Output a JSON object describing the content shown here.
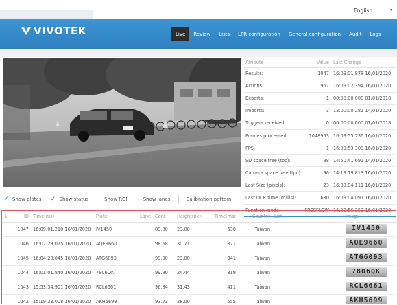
{
  "language": {
    "selected": "English"
  },
  "brand": {
    "name": "VIVOTEK"
  },
  "nav": {
    "items": [
      {
        "label": "Live",
        "active": true
      },
      {
        "label": "Review",
        "active": false
      },
      {
        "label": "Lists",
        "active": false
      },
      {
        "label": "LPR configuration",
        "active": false
      },
      {
        "label": "General configuration",
        "active": false
      },
      {
        "label": "Audit",
        "active": false
      },
      {
        "label": "Logs",
        "active": false
      }
    ]
  },
  "checkboxes": [
    {
      "label": "Show plates",
      "checked": true
    },
    {
      "label": "Show status",
      "checked": true
    },
    {
      "label": "Show ROI",
      "checked": false
    },
    {
      "label": "Show lanes",
      "checked": false
    },
    {
      "label": "Calibration pattern",
      "checked": false
    }
  ],
  "stats": {
    "headers": {
      "attribute": "Atribute",
      "value": "Value",
      "last_change": "Last Change"
    },
    "rows": [
      {
        "attribute": "Results:",
        "value": "1047",
        "last_change": "16:09:01.878 16/01/2020"
      },
      {
        "attribute": "Actions:",
        "value": "967",
        "last_change": "16:09:02.394 16/01/2020"
      },
      {
        "attribute": "Exports:",
        "value": "1",
        "last_change": "00:00:00.000 01/01/2018"
      },
      {
        "attribute": "Imports:",
        "value": "3",
        "last_change": "13:00:00.281 14/01/2020"
      },
      {
        "attribute": "Triggers received:",
        "value": "0",
        "last_change": "00:00:00.000 01/01/2018"
      },
      {
        "attribute": "Frames processed:",
        "value": "1048953",
        "last_change": "16:09:55.736 16/01/2020"
      },
      {
        "attribute": "FPS:",
        "value": "1",
        "last_change": "16:09:53.309 16/01/2020"
      },
      {
        "attribute": "SD space free (tpc):",
        "value": "98",
        "last_change": "14:50:41.692 14/01/2020"
      },
      {
        "attribute": "Camera space free (tpc):",
        "value": "96",
        "last_change": "14:13:19.813 16/01/2020"
      },
      {
        "attribute": "Last Size (pixels):",
        "value": "23",
        "last_change": "16:09:04.111 16/01/2020"
      },
      {
        "attribute": "Last OCR time (millis):",
        "value": "630",
        "last_change": "16:09:04.097 16/01/2020"
      },
      {
        "attribute": "Function mode:",
        "value": "FREEFLOW",
        "last_change": "16:09:56.352 16/01/2020"
      }
    ]
  },
  "results": {
    "headers": {
      "sort": "↓",
      "id": "ID",
      "time": "Time(ms)",
      "plate": "Plate",
      "lane": "Lane",
      "conf": "Conf.",
      "height": "Height(px)",
      "timems": "Time(ms)",
      "country": "Country",
      "list": "List",
      "image": "Image"
    },
    "rows": [
      {
        "id": "1047",
        "time": "16:09:01.210 16/01/2020",
        "plate": "IV1450",
        "conf": "89.80",
        "height": "23.00",
        "timems": "630",
        "country": "Taiwan",
        "image_text": "IV1450"
      },
      {
        "id": "1046",
        "time": "16:07:29.075 16/01/2020",
        "plate": "AQE9660",
        "conf": "98.68",
        "height": "30.71",
        "timems": "371",
        "country": "Taiwan",
        "image_text": "AQE9660"
      },
      {
        "id": "1045",
        "time": "16:04:20.045 16/01/2020",
        "plate": "ATG6093",
        "conf": "99.90",
        "height": "23.00",
        "timems": "341",
        "country": "Taiwan",
        "image_text": "ATG6093"
      },
      {
        "id": "1044",
        "time": "16:01:01.840 16/01/2020",
        "plate": "7806QK",
        "conf": "99.90",
        "height": "24.44",
        "timems": "319",
        "country": "Taiwan",
        "image_text": "7806QK"
      },
      {
        "id": "1043",
        "time": "15:53:34.901 16/01/2020",
        "plate": "RCL6661",
        "conf": "96.84",
        "height": "31.43",
        "timems": "411",
        "country": "Taiwan",
        "image_text": "RCL6661"
      },
      {
        "id": "1042",
        "time": "15:19:33.008 16/01/2020",
        "plate": "AKH5699",
        "conf": "93.73",
        "height": "28.00",
        "timems": "555",
        "country": "Taiwan",
        "image_text": "AKH5699"
      }
    ]
  }
}
